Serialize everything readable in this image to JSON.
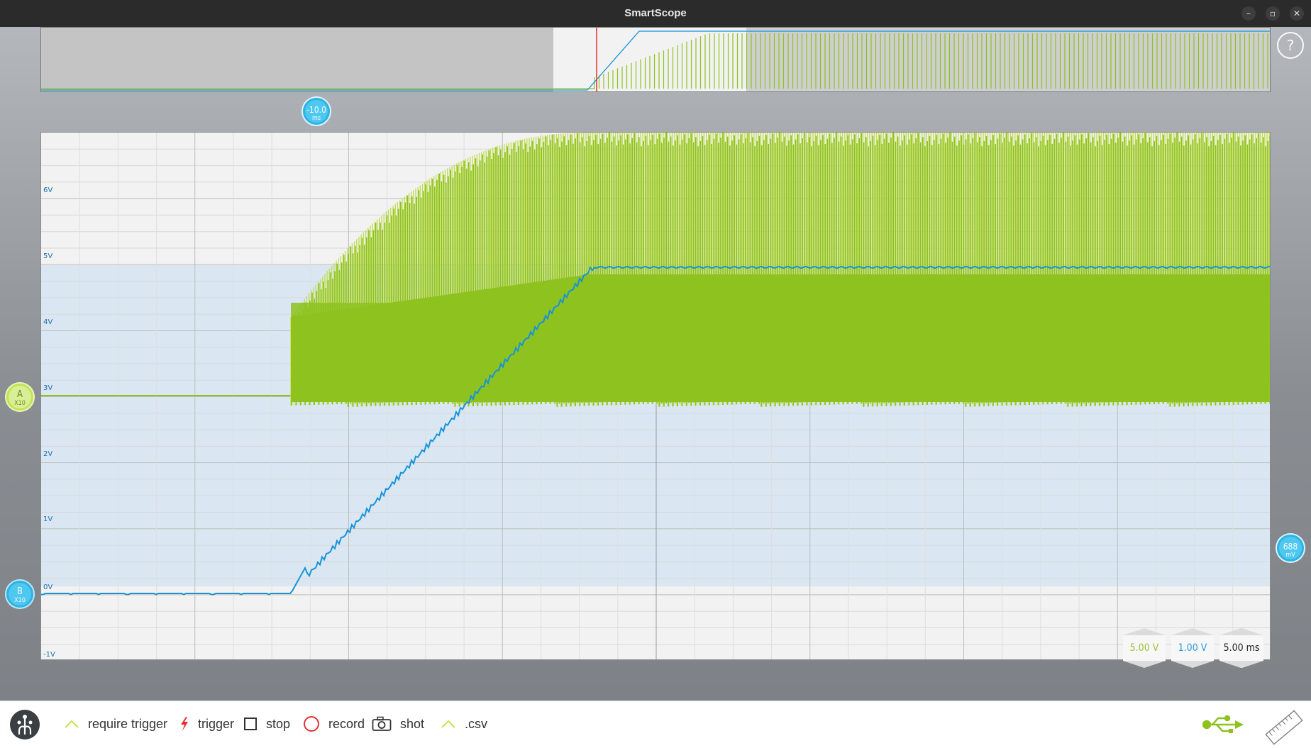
{
  "window": {
    "title": "SmartScope",
    "controls": {
      "minimize": "–",
      "maximize": "▫",
      "close": "✕"
    }
  },
  "colors": {
    "channel_a": "#8dc21f",
    "channel_a_light": "#c2dd5a",
    "channel_b": "#1693d9",
    "marker_blue": "#4fc8f0",
    "trigger_red": "#e53030",
    "b_region": "#dae7f2",
    "grid": "#c9c9c9",
    "toolbar_bg": "#ffffff"
  },
  "scope": {
    "y_labels": [
      "6V",
      "5V",
      "4V",
      "3V",
      "2V",
      "1V",
      "0V",
      "-1V"
    ],
    "channel_a_marker": {
      "name": "A",
      "probe": "X10"
    },
    "channel_b_marker": {
      "name": "B",
      "probe": "X10"
    },
    "time_marker": {
      "value": "-10.0",
      "unit": "ms"
    },
    "level_marker": {
      "value": "688",
      "unit": "mV"
    },
    "help_icon": "?"
  },
  "scales": {
    "channel_a": "5.00 V",
    "channel_b": "1.00 V",
    "time": "5.00 ms"
  },
  "toolbar": {
    "items": [
      {
        "label": "require trigger",
        "icon": "trigger-edge-icon"
      },
      {
        "label": "trigger",
        "icon": "lightning-icon"
      },
      {
        "label": "stop",
        "icon": "square-icon"
      },
      {
        "label": "record",
        "icon": "circle-icon"
      },
      {
        "label": "shot",
        "icon": "camera-icon"
      },
      {
        "label": ".csv",
        "icon": "csv-edge-icon"
      }
    ]
  }
}
